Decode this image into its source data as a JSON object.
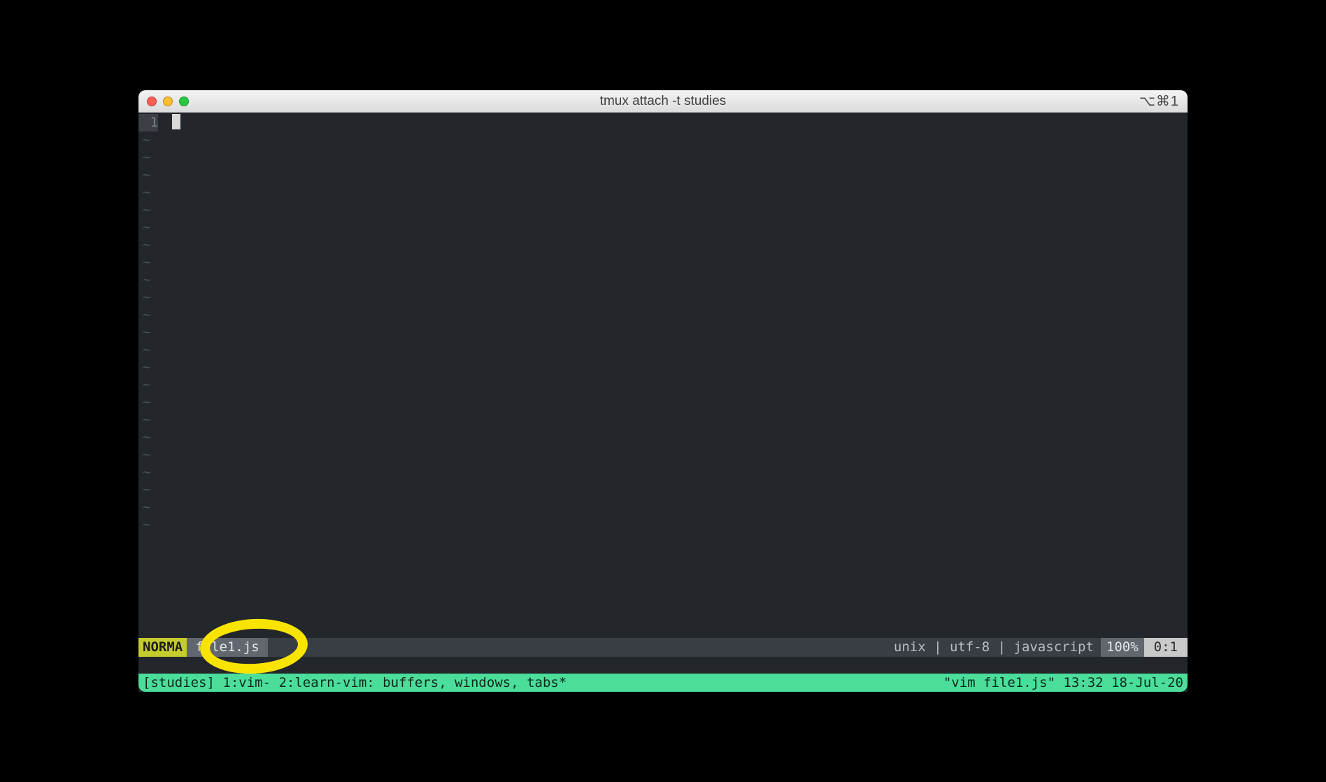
{
  "titlebar": {
    "title": "tmux attach -t studies",
    "shortcut": "⌥⌘1"
  },
  "editor": {
    "line_number": "1",
    "tilde": "~",
    "tilde_count": 23
  },
  "status": {
    "mode": "NORMA",
    "filename": "file1.js",
    "right_info": "unix | utf-8 | javascript",
    "percent": "100%",
    "position": "0:1"
  },
  "tmux": {
    "left": "[studies] 1:vim- 2:learn-vim: buffers, windows, tabs*",
    "right": "\"vim file1.js\" 13:32 18-Jul-20"
  }
}
